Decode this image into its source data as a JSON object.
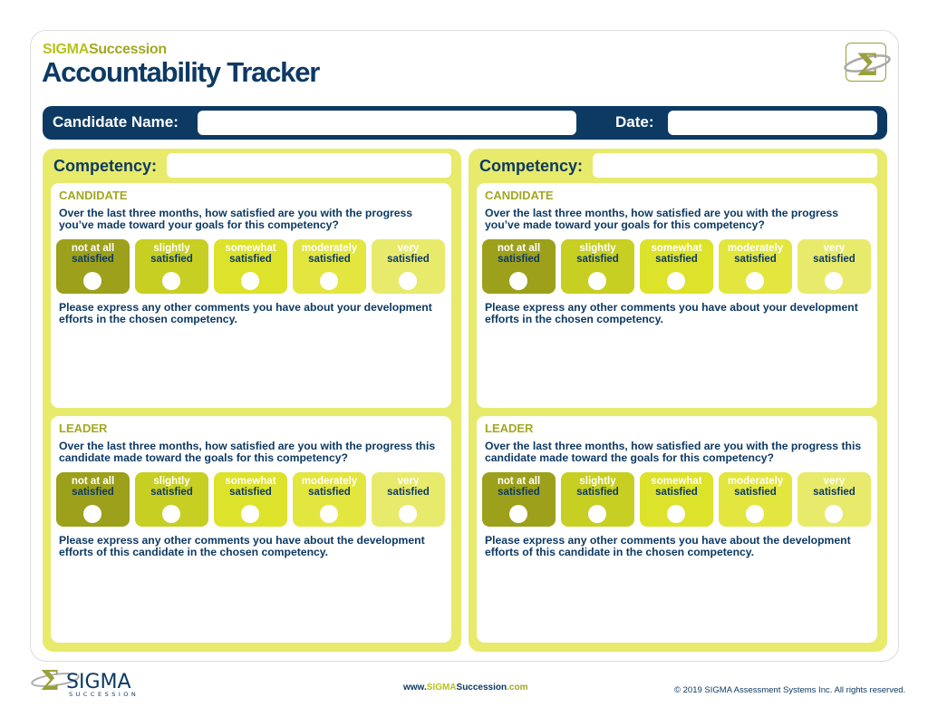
{
  "header": {
    "brand_part1": "SIGMA",
    "brand_part2": "Succession",
    "title": "Accountability Tracker"
  },
  "name_bar": {
    "candidate_label": "Candidate Name:",
    "candidate_value": "",
    "date_label": "Date:",
    "date_value": ""
  },
  "colors": {
    "navy": "#0d3a63",
    "panel": "#e8ea6c",
    "accent": "#a2a820",
    "scale": [
      "#9ca01b",
      "#c7cf22",
      "#dde22b",
      "#e3e63f",
      "#e8ea6c"
    ]
  },
  "scale_options": [
    {
      "line1": "not at all",
      "line2": "satisfied"
    },
    {
      "line1": "slightly",
      "line2": "satisfied"
    },
    {
      "line1": "somewhat",
      "line2": "satisfied"
    },
    {
      "line1": "moderately",
      "line2": "satisfied"
    },
    {
      "line1": "very",
      "line2": "satisfied"
    }
  ],
  "panels": [
    {
      "competency_label": "Competency:",
      "competency_value": "",
      "candidate": {
        "role": "CANDIDATE",
        "question": "Over the last three months, how satisfied are you with the progress you’ve made toward your goals for this competency?",
        "comment_prompt": "Please express any other comments you have about your development efforts in the chosen competency."
      },
      "leader": {
        "role": "LEADER",
        "question": "Over the last three months, how satisfied are you with the progress this candidate made toward the goals for this competency?",
        "comment_prompt": "Please express any other comments you have about the development efforts of this candidate in the chosen competency."
      }
    },
    {
      "competency_label": "Competency:",
      "competency_value": "",
      "candidate": {
        "role": "CANDIDATE",
        "question": "Over the last three months, how satisfied are you with the progress you’ve made toward your goals for this competency?",
        "comment_prompt": "Please express any other comments you have about your development efforts in the chosen competency."
      },
      "leader": {
        "role": "LEADER",
        "question": "Over the last three months, how satisfied are you with the progress this candidate made toward the goals for this competency?",
        "comment_prompt": "Please express any other comments you have about the development efforts of this candidate in the chosen competency."
      }
    }
  ],
  "footer": {
    "logo_word": "SIGMA",
    "logo_sub": "SUCCESSION",
    "url_prefix": "www.",
    "url_sigma": "SIGMA",
    "url_succ": "Succession",
    "url_suffix": ".com",
    "copyright": "© 2019 SIGMA Assessment Systems Inc. All rights reserved."
  }
}
